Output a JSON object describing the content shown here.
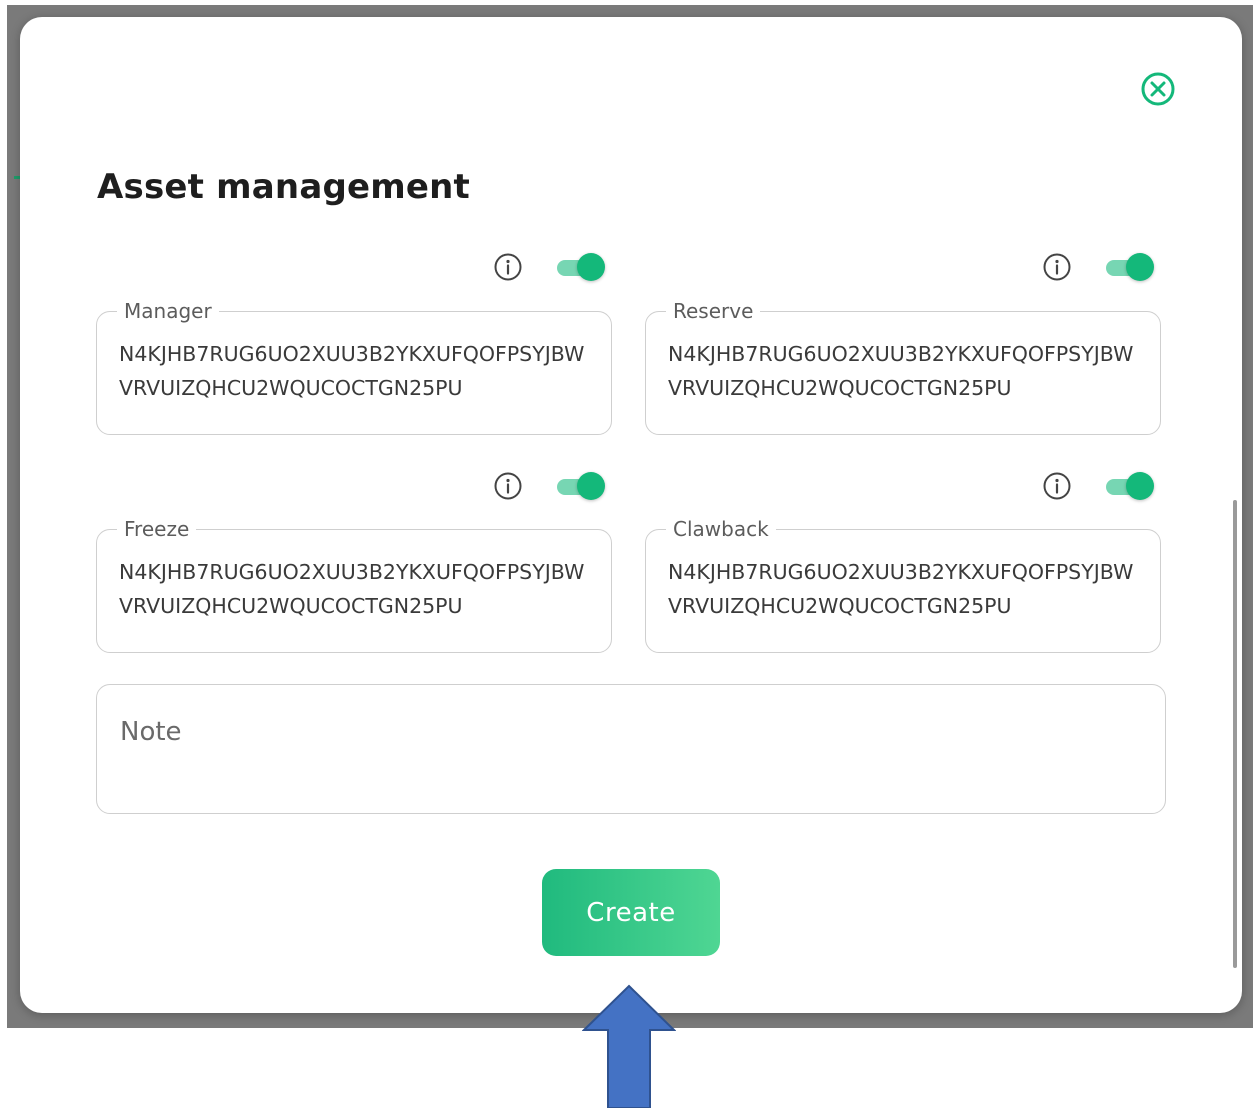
{
  "modal": {
    "title": "Asset management",
    "close_icon": "close-circle-icon"
  },
  "fields": [
    {
      "key": "manager",
      "label": "Manager",
      "value": "N4KJHB7RUG6UO2XUU3B2YKXUFQOFPSYJBWVRVUIZQHCU2WQUCOCTGN25PU",
      "toggle_on": true,
      "info_icon": "info-icon"
    },
    {
      "key": "reserve",
      "label": "Reserve",
      "value": "N4KJHB7RUG6UO2XUU3B2YKXUFQOFPSYJBWVRVUIZQHCU2WQUCOCTGN25PU",
      "toggle_on": true,
      "info_icon": "info-icon"
    },
    {
      "key": "freeze",
      "label": "Freeze",
      "value": "N4KJHB7RUG6UO2XUU3B2YKXUFQOFPSYJBWVRVUIZQHCU2WQUCOCTGN25PU",
      "toggle_on": true,
      "info_icon": "info-icon"
    },
    {
      "key": "clawback",
      "label": "Clawback",
      "value": "N4KJHB7RUG6UO2XUU3B2YKXUFQOFPSYJBWVRVUIZQHCU2WQUCOCTGN25PU",
      "toggle_on": true,
      "info_icon": "info-icon"
    }
  ],
  "note": {
    "placeholder": "Note"
  },
  "create_button": {
    "label": "Create"
  },
  "colors": {
    "accent": "#14b87a",
    "button_gradient_start": "#20ba7e",
    "button_gradient_end": "#4fd693",
    "annotation_arrow": "#4472c4",
    "backdrop": "#7a7a7a"
  }
}
